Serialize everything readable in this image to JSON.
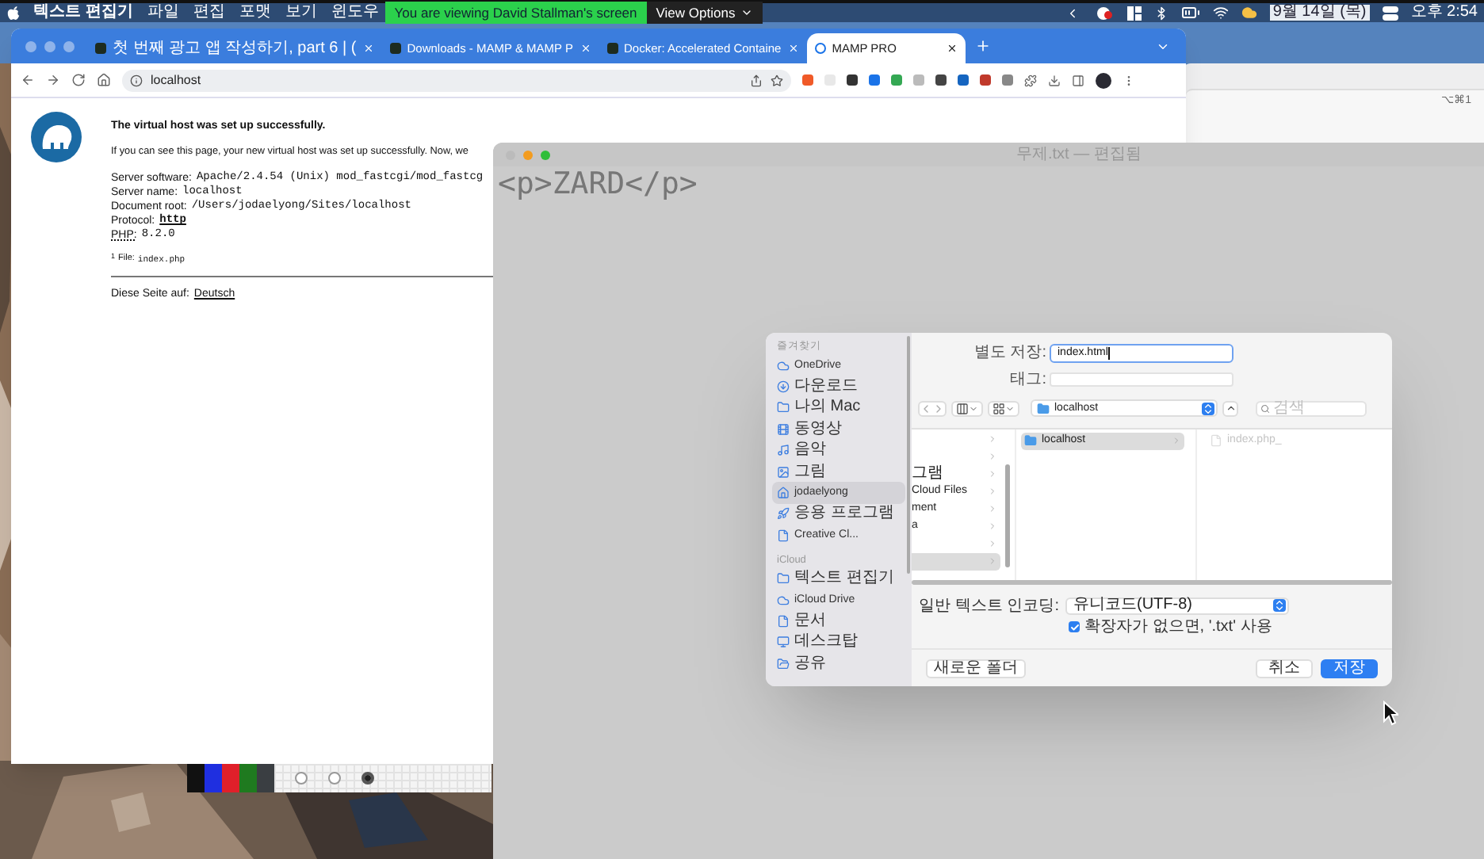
{
  "menu_bar": {
    "app": "텍스트 편집기",
    "menus": [
      "파일",
      "편집",
      "포맷",
      "보기",
      "윈도우"
    ],
    "date": "9월 14일 (목)",
    "time": "오후 2:54"
  },
  "share_banner": {
    "message": "You are viewing David Stallman's screen",
    "options": "View Options"
  },
  "browser": {
    "tabs": [
      {
        "title": "첫 번째 광고 앱 작성하기, part 6 | (",
        "selected": false
      },
      {
        "title": "Downloads - MAMP & MAMP P",
        "selected": false
      },
      {
        "title": "Docker: Accelerated Containe",
        "selected": false
      },
      {
        "title": "MAMP PRO",
        "selected": true
      }
    ],
    "address": "localhost",
    "page": {
      "heading": "The virtual host was set up successfully.",
      "intro": "If you can see this page, your new virtual host was set up successfully. Now, we",
      "details": [
        {
          "label": "Server software:",
          "value": "Apache/2.4.54 (Unix) mod_fastcgi/mod_fastcg",
          "link": false
        },
        {
          "label": "Server name:",
          "value": "localhost",
          "link": false
        },
        {
          "label": "Document root:",
          "value": "/Users/jodaelyong/Sites/localhost",
          "link": false
        },
        {
          "label": "Protocol:",
          "value": "http",
          "link": true
        },
        {
          "label": "PHP:",
          "value": "8.2.0",
          "link": false
        }
      ],
      "footnote_mark": "1",
      "footnote_label": "File:",
      "footnote_file": "index.php",
      "language_label": "Diese Seite auf:",
      "language_link": "Deutsch"
    }
  },
  "back_window": {
    "shortcut": "⌥⌘1"
  },
  "text_editor": {
    "title": "무제.txt — 편집됨",
    "content": "<p>ZARD</p>"
  },
  "save_dialog": {
    "sidebar": [
      {
        "kind": "header",
        "label": "즐겨찾기"
      },
      {
        "kind": "item",
        "label": "OneDrive",
        "selected": false
      },
      {
        "kind": "item",
        "label": "다운로드",
        "selected": false
      },
      {
        "kind": "item",
        "label": "나의 Mac",
        "selected": false
      },
      {
        "kind": "item",
        "label": "동영상",
        "selected": false
      },
      {
        "kind": "item",
        "label": "음악",
        "selected": false
      },
      {
        "kind": "item",
        "label": "그림",
        "selected": false
      },
      {
        "kind": "item",
        "label": "jodaelyong",
        "selected": true
      },
      {
        "kind": "item",
        "label": "응용 프로그램",
        "selected": false
      },
      {
        "kind": "item",
        "label": "Creative Cl...",
        "selected": false
      },
      {
        "kind": "header",
        "label": "iCloud"
      },
      {
        "kind": "item",
        "label": "텍스트 편집기",
        "selected": false
      },
      {
        "kind": "item",
        "label": "iCloud Drive",
        "selected": false
      },
      {
        "kind": "item",
        "label": "문서",
        "selected": false
      },
      {
        "kind": "item",
        "label": "데스크탑",
        "selected": false
      },
      {
        "kind": "item",
        "label": "공유",
        "selected": false
      }
    ],
    "save_as_label": "별도 저장:",
    "filename": "index.html",
    "tags_label": "태그:",
    "location": "localhost",
    "search_placeholder": "검색",
    "column_1": [
      {
        "selected": false
      },
      {
        "selected": false
      },
      {
        "label": "그램",
        "selected": false
      },
      {
        "label": "Cloud Files",
        "selected": false
      },
      {
        "label": "ment",
        "selected": false
      },
      {
        "label": "a",
        "selected": false
      },
      {
        "selected": false
      },
      {
        "selected": true
      }
    ],
    "column_2": [
      {
        "label": "localhost",
        "selected": true
      }
    ],
    "column_3": [
      {
        "label": "index.php_",
        "disabled": true
      }
    ],
    "encoding_label": "일반 텍스트 인코딩:",
    "encoding": "유니코드(UTF-8)",
    "extension_option": {
      "label": "확장자가 없으면, '.txt' 사용",
      "checked": true
    },
    "new_folder": "새로운 폴더",
    "cancel": "취소",
    "save": "저장"
  },
  "drawing_toolbar": {
    "pens": [
      {
        "color": "#111111"
      },
      {
        "color": "#1f2fe0"
      },
      {
        "color": "#e0202a"
      },
      {
        "color": "#1f7a1f"
      },
      {
        "color": "#3a3e42"
      }
    ],
    "sizes": [
      {
        "selected": false
      },
      {
        "selected": false
      },
      {
        "selected": true
      }
    ]
  }
}
